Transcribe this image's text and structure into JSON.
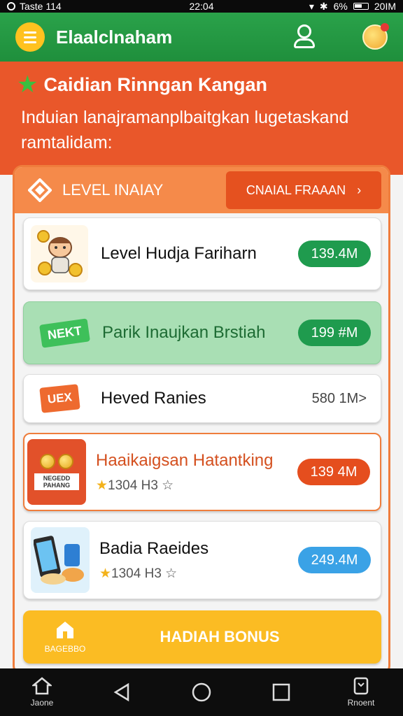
{
  "status_bar": {
    "left_text": "Taste 114",
    "time": "22:04",
    "battery_text": "6%",
    "right_text": "20IM"
  },
  "header": {
    "title": "Elaalclnaham",
    "icons": [
      "menu-icon",
      "user-icon",
      "mascot-icon"
    ]
  },
  "banner": {
    "title": "Caidian Rinngan Kangan",
    "description": "Induian lanajramanplbaitgkan lugetaskand ramtalidam:"
  },
  "panel": {
    "title": "LEVEL INAIAY",
    "action_label": "CNAIAL FRAAAN",
    "cards": [
      {
        "title": "Level Hudja Fariharn",
        "value": "139.4M",
        "style": "green"
      },
      {
        "title": "Parik Inaujkan Brstiah",
        "value": "199 #M",
        "style": "green",
        "thumb_text": "NEKT"
      },
      {
        "title": "Heved Ranies",
        "value": "580 1M>",
        "style": "plain",
        "thumb_text": "UEX"
      },
      {
        "title": "Haaikaigsan Hatantking",
        "sub": "1304 H3 ☆",
        "value": "139 4M",
        "style": "red",
        "thumb_text": "NEGEDD PAHANG"
      },
      {
        "title": "Badia Raeides",
        "sub": "1304 H3 ☆",
        "value": "249.4M",
        "style": "blue"
      }
    ],
    "bonus": {
      "label": "HADIAH BONUS",
      "icon_label": "BAGEBBO"
    }
  },
  "nav": {
    "home_label": "Jaone",
    "right_label": "Rnoent"
  }
}
